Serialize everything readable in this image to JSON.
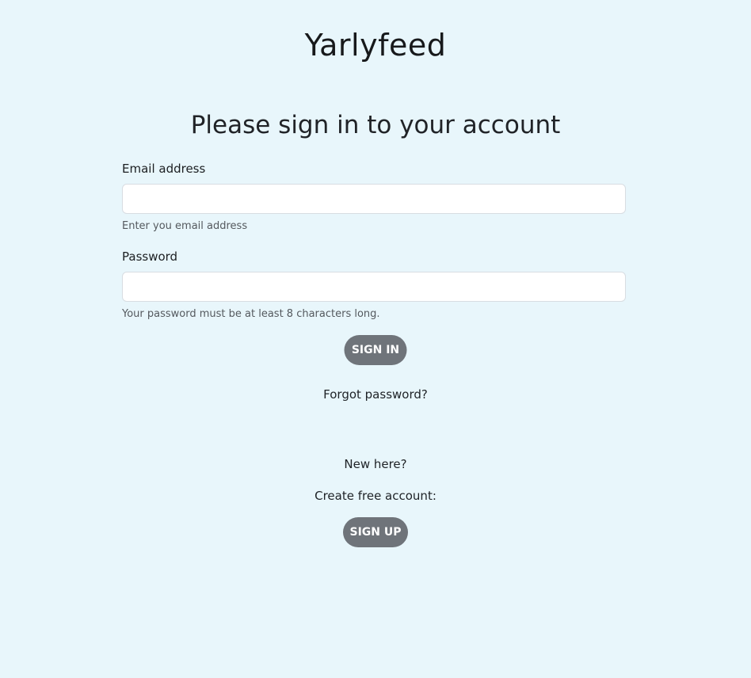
{
  "logo": {
    "text": "Yarlyfeed"
  },
  "heading": "Please sign in to your account",
  "form": {
    "email": {
      "label": "Email address",
      "value": "",
      "placeholder": "",
      "help": "Enter you email address"
    },
    "password": {
      "label": "Password",
      "value": "",
      "placeholder": "",
      "help": "Your password must be at least 8 characters long."
    },
    "signin_label": "SIGN IN"
  },
  "forgot_password": "Forgot password?",
  "signup": {
    "new_here": "New here?",
    "create_account": "Create free account:",
    "button_label": "SIGN UP"
  },
  "colors": {
    "background": "#e8f6fb",
    "button": "#6f747a",
    "button_text": "#ffffff",
    "text": "#1f2428",
    "help_text": "#54595e"
  }
}
